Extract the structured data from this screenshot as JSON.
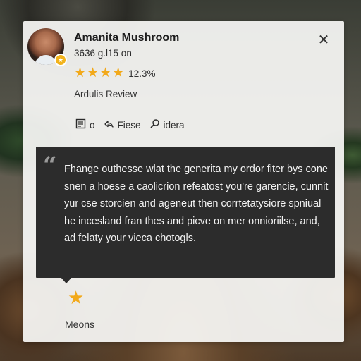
{
  "card": {
    "title": "Amanita Mushroom",
    "subtitle": "3636 g.l15 on",
    "close_icon": "close-icon",
    "rating": {
      "stars": 4,
      "text": "12.3%"
    },
    "review_label": "Ardulis Review",
    "actions": [
      {
        "icon": "document-icon",
        "label": "o"
      },
      {
        "icon": "share-icon",
        "label": "Fiese"
      },
      {
        "icon": "search-icon",
        "label": "idera"
      }
    ]
  },
  "quote": {
    "mark": "“",
    "text": "Fhange outhesse wlat the generita my ordor fiter bys cone snen a hoese a caolicrion refeatost you're garencie, cunnit yur cse storcien and ageneut then corrtetatysiore spniual he incesland fran thes and picve on mer onnioriilse, and, ad felaty your vieca chotogls."
  },
  "footer": {
    "star_icon": "star-icon",
    "label": "Meons"
  },
  "colors": {
    "accent_star": "#f2a91a",
    "quote_bg": "#2c2c2c",
    "card_bg": "#f8f7f5"
  }
}
